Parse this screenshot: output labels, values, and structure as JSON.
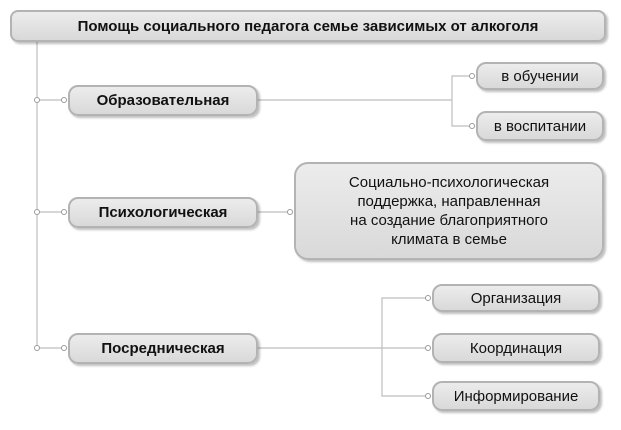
{
  "root": {
    "label": "Помощь социального педагога семье зависимых от алкоголя"
  },
  "branches": [
    {
      "label": "Образовательная",
      "children": [
        "в обучении",
        "в воспитании"
      ]
    },
    {
      "label": "Психологическая",
      "note_lines": [
        "Социально-психологическая",
        "поддержка, направленная",
        "на создание благоприятного",
        "климата в семье"
      ]
    },
    {
      "label": "Посредническая",
      "children": [
        "Организация",
        "Координация",
        "Информирование"
      ]
    }
  ],
  "colors": {
    "node_fill": "#e3e3e3",
    "node_border": "#b3b3b3",
    "line": "#bdbdbd"
  }
}
